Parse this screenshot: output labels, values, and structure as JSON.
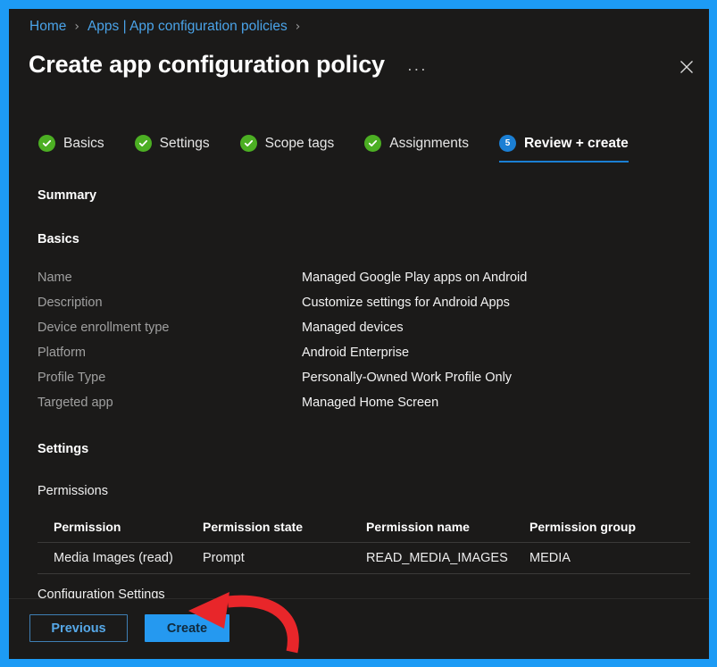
{
  "window": {
    "close_icon": "close-icon",
    "frame_color": "#1d9bf5",
    "panel_bg": "#1b1a19"
  },
  "breadcrumb": {
    "items": [
      {
        "label": "Home"
      },
      {
        "label": "Apps | App configuration policies"
      }
    ],
    "separator": "›"
  },
  "header": {
    "title": "Create app configuration policy",
    "more_label": "···",
    "more_icon": "ellipsis-icon"
  },
  "wizard": {
    "active_index": 4,
    "active_color": "#1b7fd4",
    "done_color": "#4caf23",
    "steps": [
      {
        "label": "Basics",
        "state": "done",
        "badge": "check-icon"
      },
      {
        "label": "Settings",
        "state": "done",
        "badge": "check-icon"
      },
      {
        "label": "Scope tags",
        "state": "done",
        "badge": "check-icon"
      },
      {
        "label": "Assignments",
        "state": "done",
        "badge": "check-icon"
      },
      {
        "label": "Review + create",
        "state": "active",
        "badge": "5"
      }
    ]
  },
  "summary": {
    "heading": "Summary",
    "basics": {
      "heading": "Basics",
      "rows": [
        {
          "label": "Name",
          "value": "Managed Google Play apps on Android"
        },
        {
          "label": "Description",
          "value": "Customize settings for Android Apps"
        },
        {
          "label": "Device enrollment type",
          "value": "Managed devices"
        },
        {
          "label": "Platform",
          "value": "Android Enterprise"
        },
        {
          "label": "Profile Type",
          "value": "Personally-Owned Work Profile Only"
        },
        {
          "label": "Targeted app",
          "value": "Managed Home Screen"
        }
      ]
    },
    "settings": {
      "heading": "Settings",
      "permissions_label": "Permissions",
      "table": {
        "columns": [
          "Permission",
          "Permission state",
          "Permission name",
          "Permission group"
        ],
        "rows": [
          [
            "Media Images (read)",
            "Prompt",
            "READ_MEDIA_IMAGES",
            "MEDIA"
          ]
        ]
      },
      "configuration_settings_label": "Configuration Settings"
    }
  },
  "footer": {
    "previous_label": "Previous",
    "create_label": "Create",
    "create_bg": "#2599f0"
  },
  "annotation": {
    "arrow_color": "#e8262a",
    "arrow_icon": "curved-arrow-icon",
    "points_to": "create-button"
  }
}
